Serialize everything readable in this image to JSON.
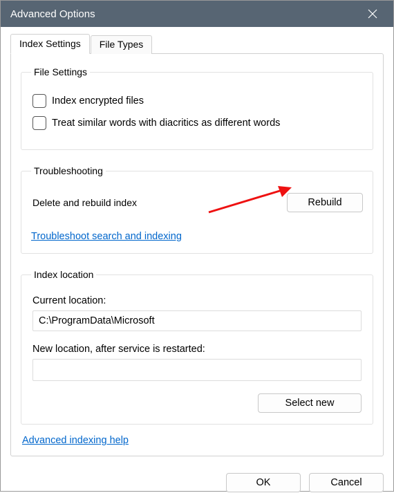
{
  "window": {
    "title": "Advanced Options"
  },
  "tabs": {
    "index_settings": "Index Settings",
    "file_types": "File Types"
  },
  "file_settings": {
    "legend": "File Settings",
    "encrypted_label": "Index encrypted files",
    "diacritics_label": "Treat similar words with diacritics as different words"
  },
  "troubleshooting": {
    "legend": "Troubleshooting",
    "rebuild_text": "Delete and rebuild index",
    "rebuild_button": "Rebuild",
    "link": "Troubleshoot search and indexing"
  },
  "index_location": {
    "legend": "Index location",
    "current_label": "Current location:",
    "current_path": "C:\\ProgramData\\Microsoft",
    "new_label": "New location, after service is restarted:",
    "new_path": "",
    "select_button": "Select new"
  },
  "help_link": "Advanced indexing help",
  "buttons": {
    "ok": "OK",
    "cancel": "Cancel"
  }
}
